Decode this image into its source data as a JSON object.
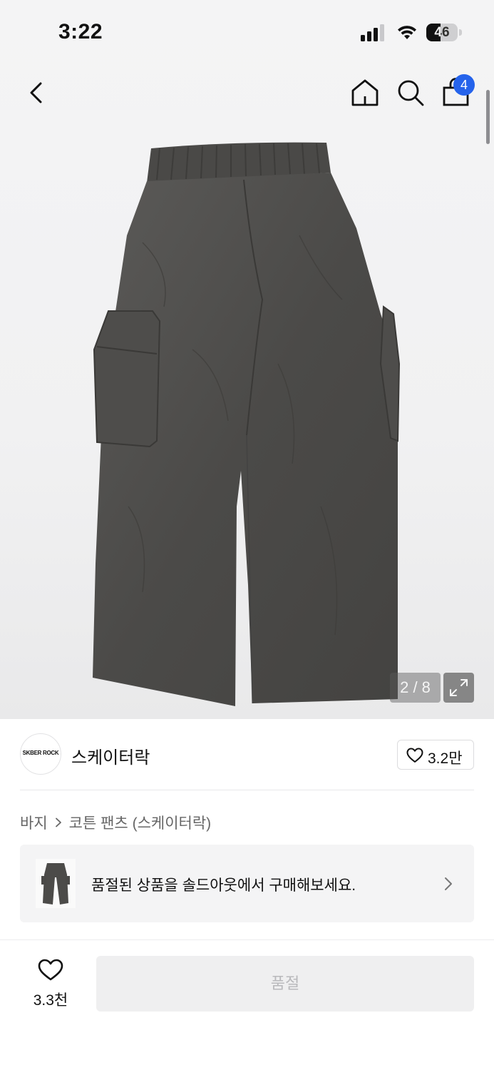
{
  "status_bar": {
    "time": "3:22",
    "battery_level": "46",
    "battery_fraction": 0.46
  },
  "nav": {
    "back_icon": "chevron-left-icon",
    "home_icon": "home-icon",
    "search_icon": "search-icon",
    "bag_icon": "shopping-bag-icon",
    "cart_count": "4",
    "badge_color": "#2563eb"
  },
  "gallery": {
    "image_index": "2 / 8",
    "expand_icon": "expand-icon"
  },
  "brand": {
    "logo_text": "SKBER ROCK",
    "name": "스케이터락",
    "like_count": "3.2만"
  },
  "breadcrumb": {
    "category": "바지",
    "product_name": "코튼 팬츠 (스케이터락)"
  },
  "soldout_banner": {
    "text": "품절된 상품을 솔드아웃에서 구매해보세요."
  },
  "bottom_bar": {
    "wish_count": "3.3천",
    "buy_button_label": "품절"
  }
}
